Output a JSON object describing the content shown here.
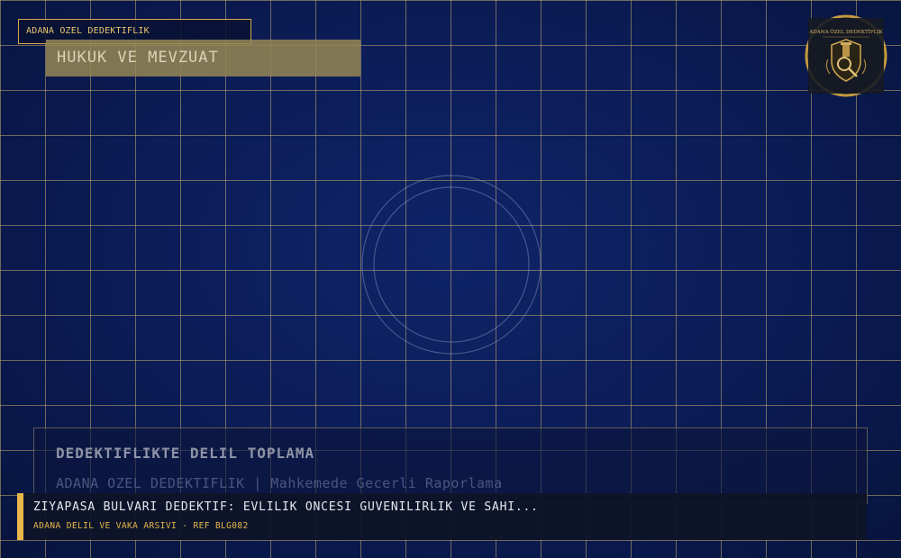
{
  "brand_tag": "ADANA OZEL DEDEKTIFLIK",
  "category": "HUKUK VE MEVZUAT",
  "logo": {
    "title": "ADANA ÖZEL DEDEKTİFLİK",
    "icon": "detective-badge-icon"
  },
  "card": {
    "title": "DEDEKTIFLIKTE DELIL TOPLAMA",
    "subtitle": "ADANA OZEL DEDEKTIFLIK | Mahkemede Gecerli Raporlama"
  },
  "ticker": {
    "headline": "ZIYAPASA BULVARI DEDEKTIF: EVLILIK ONCESI GUVENILIRLIK VE SAHI...",
    "ref": "ADANA DELIL VE VAKA ARSIVI - REF BLG082"
  },
  "colors": {
    "background": "#0b1c55",
    "grid": "#c4aa6e",
    "accent": "#e6b84a"
  }
}
